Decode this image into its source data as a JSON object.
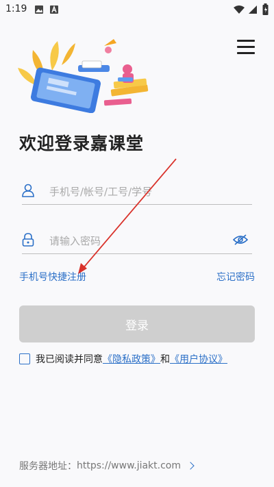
{
  "status": {
    "time": "1:19"
  },
  "title": "欢迎登录嘉课堂",
  "account": {
    "placeholder": "手机号/帐号/工号/学号"
  },
  "password": {
    "placeholder": "请输入密码"
  },
  "links": {
    "register": "手机号快捷注册",
    "forgot": "忘记密码"
  },
  "login_label": "登录",
  "agreement": {
    "prefix": "我已阅读并同意",
    "privacy": "《隐私政策》",
    "and": "和",
    "terms": "《用户协议》"
  },
  "server": {
    "label": "服务器地址：",
    "url": "https://www.jiakt.com"
  },
  "colors": {
    "accent": "#2a6fc7",
    "button_disabled": "#cfcfcf",
    "annotation": "#d9322b"
  }
}
